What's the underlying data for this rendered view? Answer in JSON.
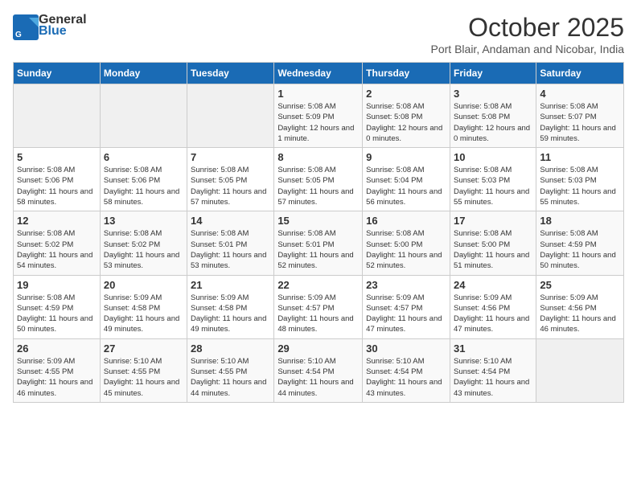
{
  "header": {
    "logo_line1": "General",
    "logo_line2": "Blue",
    "month": "October 2025",
    "location": "Port Blair, Andaman and Nicobar, India"
  },
  "weekdays": [
    "Sunday",
    "Monday",
    "Tuesday",
    "Wednesday",
    "Thursday",
    "Friday",
    "Saturday"
  ],
  "weeks": [
    [
      {
        "day": "",
        "empty": true
      },
      {
        "day": "",
        "empty": true
      },
      {
        "day": "",
        "empty": true
      },
      {
        "day": "1",
        "sunrise": "5:08 AM",
        "sunset": "5:09 PM",
        "daylight": "12 hours and 1 minute."
      },
      {
        "day": "2",
        "sunrise": "5:08 AM",
        "sunset": "5:08 PM",
        "daylight": "12 hours and 0 minutes."
      },
      {
        "day": "3",
        "sunrise": "5:08 AM",
        "sunset": "5:08 PM",
        "daylight": "12 hours and 0 minutes."
      },
      {
        "day": "4",
        "sunrise": "5:08 AM",
        "sunset": "5:07 PM",
        "daylight": "11 hours and 59 minutes."
      }
    ],
    [
      {
        "day": "5",
        "sunrise": "5:08 AM",
        "sunset": "5:06 PM",
        "daylight": "11 hours and 58 minutes."
      },
      {
        "day": "6",
        "sunrise": "5:08 AM",
        "sunset": "5:06 PM",
        "daylight": "11 hours and 58 minutes."
      },
      {
        "day": "7",
        "sunrise": "5:08 AM",
        "sunset": "5:05 PM",
        "daylight": "11 hours and 57 minutes."
      },
      {
        "day": "8",
        "sunrise": "5:08 AM",
        "sunset": "5:05 PM",
        "daylight": "11 hours and 57 minutes."
      },
      {
        "day": "9",
        "sunrise": "5:08 AM",
        "sunset": "5:04 PM",
        "daylight": "11 hours and 56 minutes."
      },
      {
        "day": "10",
        "sunrise": "5:08 AM",
        "sunset": "5:03 PM",
        "daylight": "11 hours and 55 minutes."
      },
      {
        "day": "11",
        "sunrise": "5:08 AM",
        "sunset": "5:03 PM",
        "daylight": "11 hours and 55 minutes."
      }
    ],
    [
      {
        "day": "12",
        "sunrise": "5:08 AM",
        "sunset": "5:02 PM",
        "daylight": "11 hours and 54 minutes."
      },
      {
        "day": "13",
        "sunrise": "5:08 AM",
        "sunset": "5:02 PM",
        "daylight": "11 hours and 53 minutes."
      },
      {
        "day": "14",
        "sunrise": "5:08 AM",
        "sunset": "5:01 PM",
        "daylight": "11 hours and 53 minutes."
      },
      {
        "day": "15",
        "sunrise": "5:08 AM",
        "sunset": "5:01 PM",
        "daylight": "11 hours and 52 minutes."
      },
      {
        "day": "16",
        "sunrise": "5:08 AM",
        "sunset": "5:00 PM",
        "daylight": "11 hours and 52 minutes."
      },
      {
        "day": "17",
        "sunrise": "5:08 AM",
        "sunset": "5:00 PM",
        "daylight": "11 hours and 51 minutes."
      },
      {
        "day": "18",
        "sunrise": "5:08 AM",
        "sunset": "4:59 PM",
        "daylight": "11 hours and 50 minutes."
      }
    ],
    [
      {
        "day": "19",
        "sunrise": "5:08 AM",
        "sunset": "4:59 PM",
        "daylight": "11 hours and 50 minutes."
      },
      {
        "day": "20",
        "sunrise": "5:09 AM",
        "sunset": "4:58 PM",
        "daylight": "11 hours and 49 minutes."
      },
      {
        "day": "21",
        "sunrise": "5:09 AM",
        "sunset": "4:58 PM",
        "daylight": "11 hours and 49 minutes."
      },
      {
        "day": "22",
        "sunrise": "5:09 AM",
        "sunset": "4:57 PM",
        "daylight": "11 hours and 48 minutes."
      },
      {
        "day": "23",
        "sunrise": "5:09 AM",
        "sunset": "4:57 PM",
        "daylight": "11 hours and 47 minutes."
      },
      {
        "day": "24",
        "sunrise": "5:09 AM",
        "sunset": "4:56 PM",
        "daylight": "11 hours and 47 minutes."
      },
      {
        "day": "25",
        "sunrise": "5:09 AM",
        "sunset": "4:56 PM",
        "daylight": "11 hours and 46 minutes."
      }
    ],
    [
      {
        "day": "26",
        "sunrise": "5:09 AM",
        "sunset": "4:55 PM",
        "daylight": "11 hours and 46 minutes."
      },
      {
        "day": "27",
        "sunrise": "5:10 AM",
        "sunset": "4:55 PM",
        "daylight": "11 hours and 45 minutes."
      },
      {
        "day": "28",
        "sunrise": "5:10 AM",
        "sunset": "4:55 PM",
        "daylight": "11 hours and 44 minutes."
      },
      {
        "day": "29",
        "sunrise": "5:10 AM",
        "sunset": "4:54 PM",
        "daylight": "11 hours and 44 minutes."
      },
      {
        "day": "30",
        "sunrise": "5:10 AM",
        "sunset": "4:54 PM",
        "daylight": "11 hours and 43 minutes."
      },
      {
        "day": "31",
        "sunrise": "5:10 AM",
        "sunset": "4:54 PM",
        "daylight": "11 hours and 43 minutes."
      },
      {
        "day": "",
        "empty": true
      }
    ]
  ],
  "labels": {
    "sunrise": "Sunrise:",
    "sunset": "Sunset:",
    "daylight": "Daylight:"
  }
}
